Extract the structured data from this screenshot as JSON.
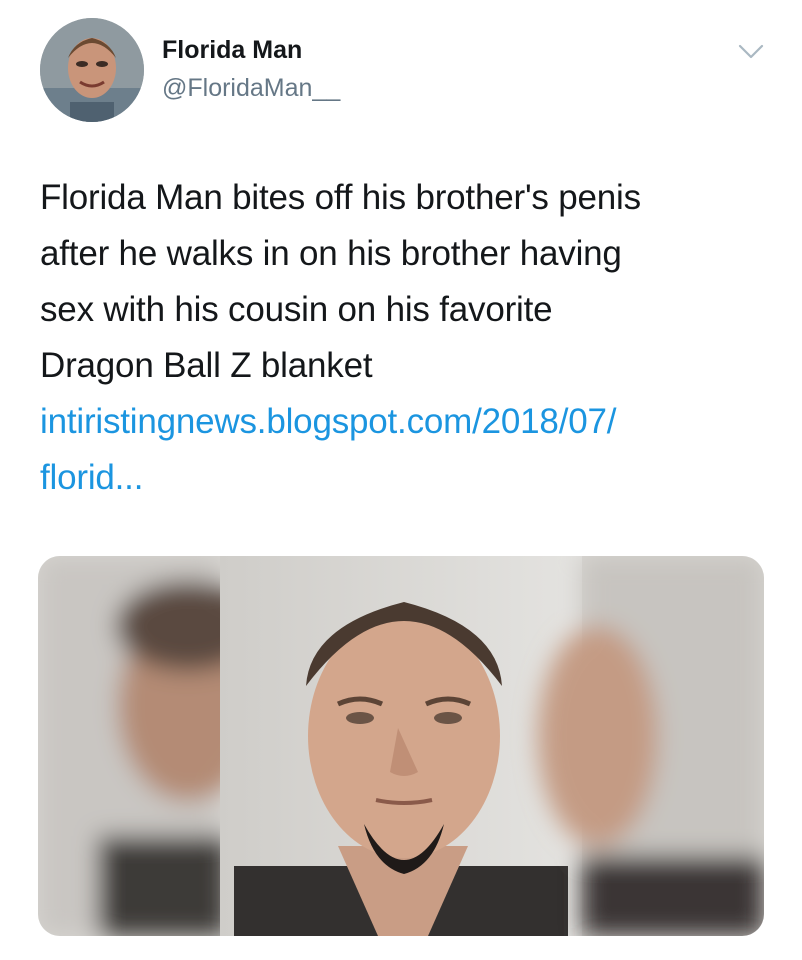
{
  "tweet": {
    "author": {
      "display_name": "Florida Man",
      "handle": "@FloridaMan__"
    },
    "menu_icon": "chevron-down-icon",
    "text_lines": [
      "Florida Man bites off his brother's penis",
      "after he walks in on his brother having",
      "sex with his cousin on his favorite",
      "Dragon Ball Z blanket"
    ],
    "link_lines": [
      "intiristingnews.blogspot.com/2018/07/",
      "florid..."
    ],
    "media": {
      "type": "photo",
      "subject": "mugshot"
    }
  },
  "colors": {
    "text": "#14171a",
    "secondary_text": "#657786",
    "link": "#1b95e0",
    "background": "#ffffff"
  }
}
